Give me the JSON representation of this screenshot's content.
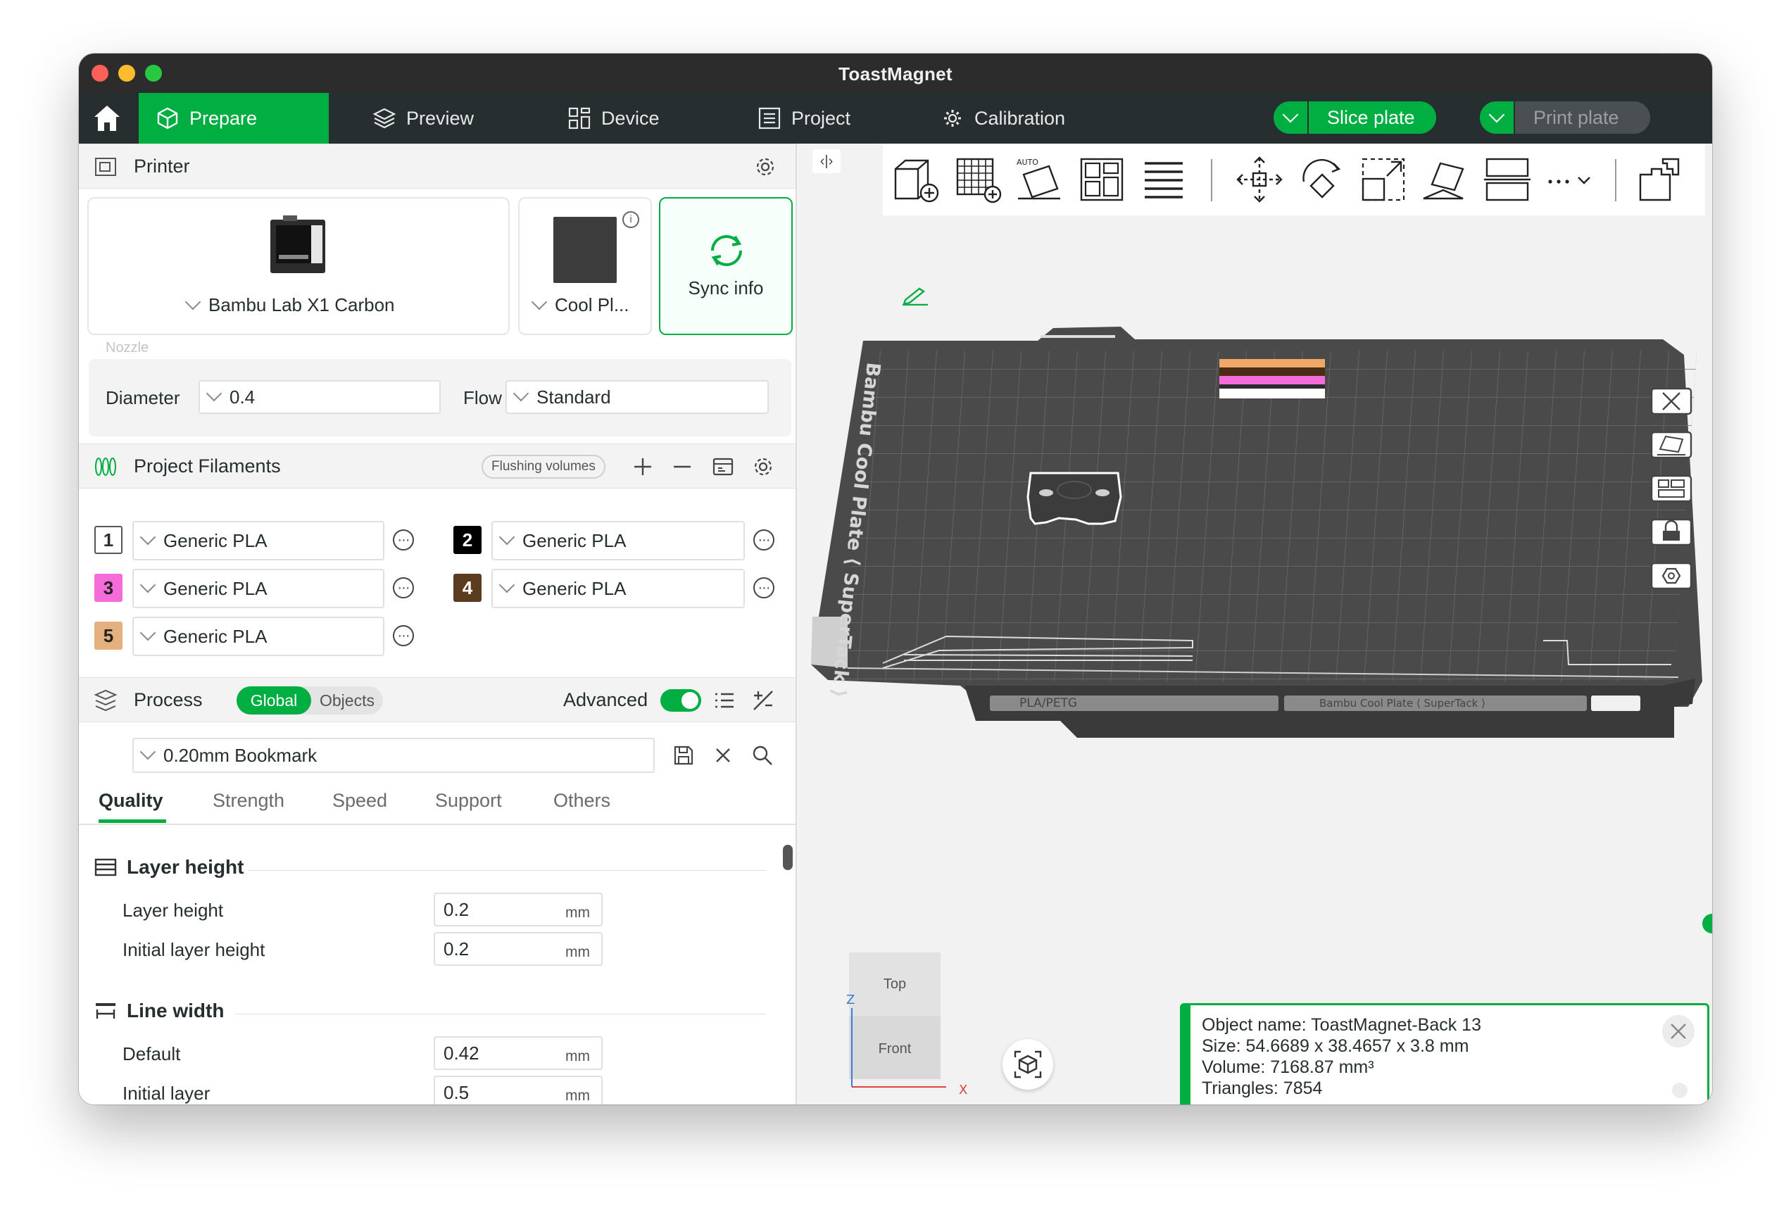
{
  "app": {
    "title": "ToastMagnet"
  },
  "nav": {
    "tabs": [
      {
        "label": "Prepare"
      },
      {
        "label": "Preview"
      },
      {
        "label": "Device"
      },
      {
        "label": "Project"
      },
      {
        "label": "Calibration"
      }
    ],
    "slice_label": "Slice plate",
    "print_label": "Print plate"
  },
  "printer": {
    "section_title": "Printer",
    "printer_name": "Bambu Lab X1 Carbon",
    "plate_name": "Cool Pl...",
    "sync_label": "Sync info",
    "nozzle_label": "Nozzle",
    "diameter_label": "Diameter",
    "diameter_value": "0.4",
    "flow_label": "Flow",
    "flow_value": "Standard"
  },
  "filaments": {
    "section_title": "Project Filaments",
    "flushing_label": "Flushing volumes",
    "items": [
      {
        "index": "1",
        "name": "Generic PLA",
        "color": "#ffffff"
      },
      {
        "index": "2",
        "name": "Generic PLA",
        "color": "#000000"
      },
      {
        "index": "3",
        "name": "Generic PLA",
        "color": "#f46bd9"
      },
      {
        "index": "4",
        "name": "Generic PLA",
        "color": "#5c3c1e"
      },
      {
        "index": "5",
        "name": "Generic PLA",
        "color": "#e3b07e"
      }
    ]
  },
  "process": {
    "section_title": "Process",
    "global_label": "Global",
    "objects_label": "Objects",
    "advanced_label": "Advanced",
    "preset": "0.20mm Bookmark",
    "tabs": [
      "Quality",
      "Strength",
      "Speed",
      "Support",
      "Others"
    ],
    "groups": [
      {
        "title": "Layer height",
        "rows": [
          {
            "label": "Layer height",
            "value": "0.2",
            "unit": "mm"
          },
          {
            "label": "Initial layer height",
            "value": "0.2",
            "unit": "mm"
          }
        ]
      },
      {
        "title": "Line width",
        "rows": [
          {
            "label": "Default",
            "value": "0.42",
            "unit": "mm"
          },
          {
            "label": "Initial layer",
            "value": "0.5",
            "unit": "mm"
          }
        ]
      }
    ]
  },
  "viewport": {
    "plate_text": "Bambu Cool Plate ⟨ SuperTack ⟩",
    "plate_footer_left": "PLA/PETG",
    "plate_footer_right": "Bambu Cool Plate ⟨ SuperTack ⟩",
    "view_top": "Top",
    "view_front": "Front",
    "axis_z": "Z",
    "axis_x": "X"
  },
  "object_info": {
    "name_line": "Object name: ToastMagnet-Back 13",
    "size_line": "Size: 54.6689 x 38.4657 x 3.8 mm",
    "volume_line": "Volume: 7168.87 mm³",
    "triangles_line": "Triangles: 7854"
  },
  "colors": {
    "accent": "#00ae42",
    "nav_bg": "#262e30",
    "plate": "#4a4a4a"
  }
}
